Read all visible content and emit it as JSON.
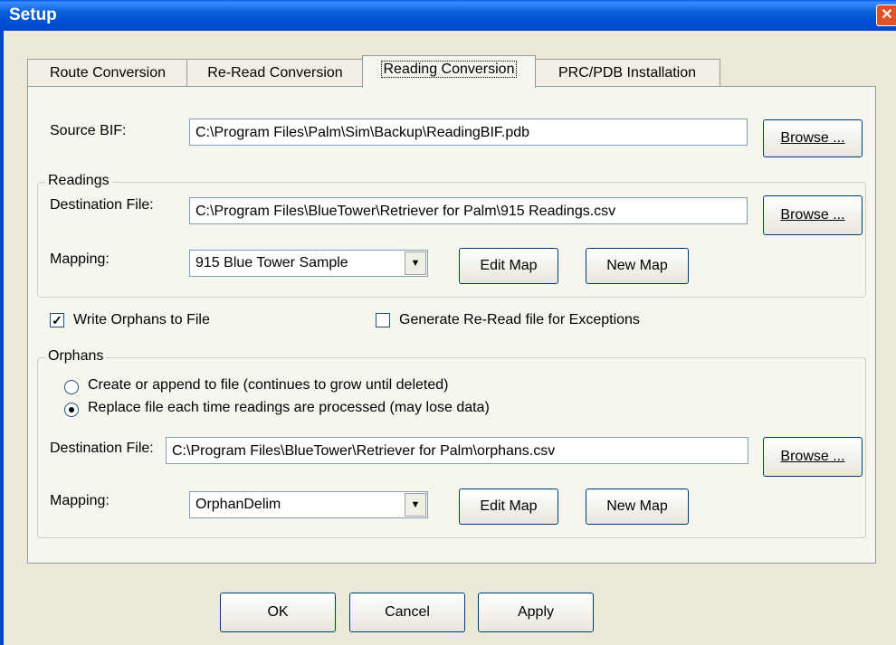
{
  "window": {
    "title": "Setup",
    "close_glyph": "✕"
  },
  "tabs": [
    {
      "label": "Route Conversion"
    },
    {
      "label": "Re-Read Conversion"
    },
    {
      "label": "Reading Conversion",
      "active": true
    },
    {
      "label": "PRC/PDB Installation"
    }
  ],
  "source": {
    "label": "Source BIF:",
    "value": "C:\\Program Files\\Palm\\Sim\\Backup\\ReadingBIF.pdb",
    "browse_label": "Browse ..."
  },
  "readings": {
    "group_title": "Readings",
    "dest_label": "Destination File:",
    "dest_value": "C:\\Program Files\\BlueTower\\Retriever for Palm\\915 Readings.csv",
    "browse_label": "Browse ...",
    "mapping_label": "Mapping:",
    "mapping_value": "915 Blue Tower Sample",
    "edit_map_label": "Edit Map",
    "new_map_label": "New Map"
  },
  "options": {
    "write_orphans_label": "Write Orphans to File",
    "write_orphans_checked": true,
    "write_orphans_mark": "✓",
    "generate_reread_label": "Generate Re-Read file for Exceptions",
    "generate_reread_checked": false
  },
  "orphans": {
    "group_title": "Orphans",
    "radio_create_label": "Create or append to file (continues to grow until deleted)",
    "radio_replace_label": "Replace file each time readings are processed (may lose data)",
    "selected": "replace",
    "dest_label": "Destination File:",
    "dest_value": "C:\\Program Files\\BlueTower\\Retriever for Palm\\orphans.csv",
    "browse_label": "Browse ...",
    "mapping_label": "Mapping:",
    "mapping_value": "OrphanDelim",
    "edit_map_label": "Edit Map",
    "new_map_label": "New Map"
  },
  "footer": {
    "ok_label": "OK",
    "cancel_label": "Cancel",
    "apply_label": "Apply"
  },
  "icons": {
    "dropdown_arrow": "▼"
  }
}
